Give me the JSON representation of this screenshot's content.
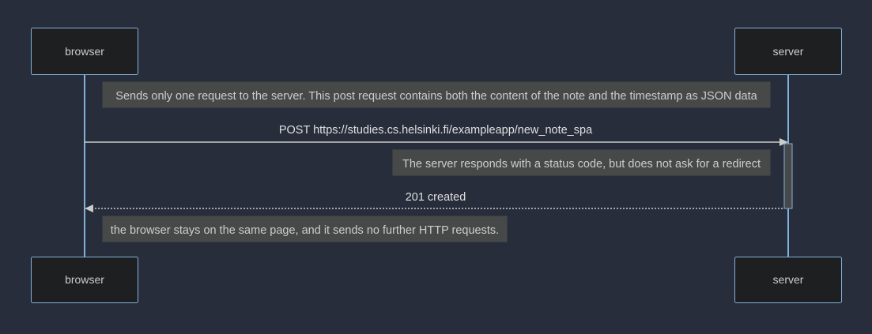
{
  "actors": {
    "browser": "browser",
    "server": "server"
  },
  "notes": {
    "request_note": "Sends only one request to the server. This post request contains both the content of the note and the timestamp as JSON data",
    "response_note": "The server responds with a status code, but does not ask for a redirect",
    "final_note": "the browser stays on the same page, and it sends no further HTTP requests."
  },
  "messages": {
    "post_request": "POST https://studies.cs.helsinki.fi/exampleapp/new_note_spa",
    "response": "201 created"
  },
  "colors": {
    "background": "#282d3b",
    "actor_fill": "#1e1f21",
    "actor_stroke": "#81b1db",
    "note_fill": "#474949",
    "text": "#cccccc"
  }
}
